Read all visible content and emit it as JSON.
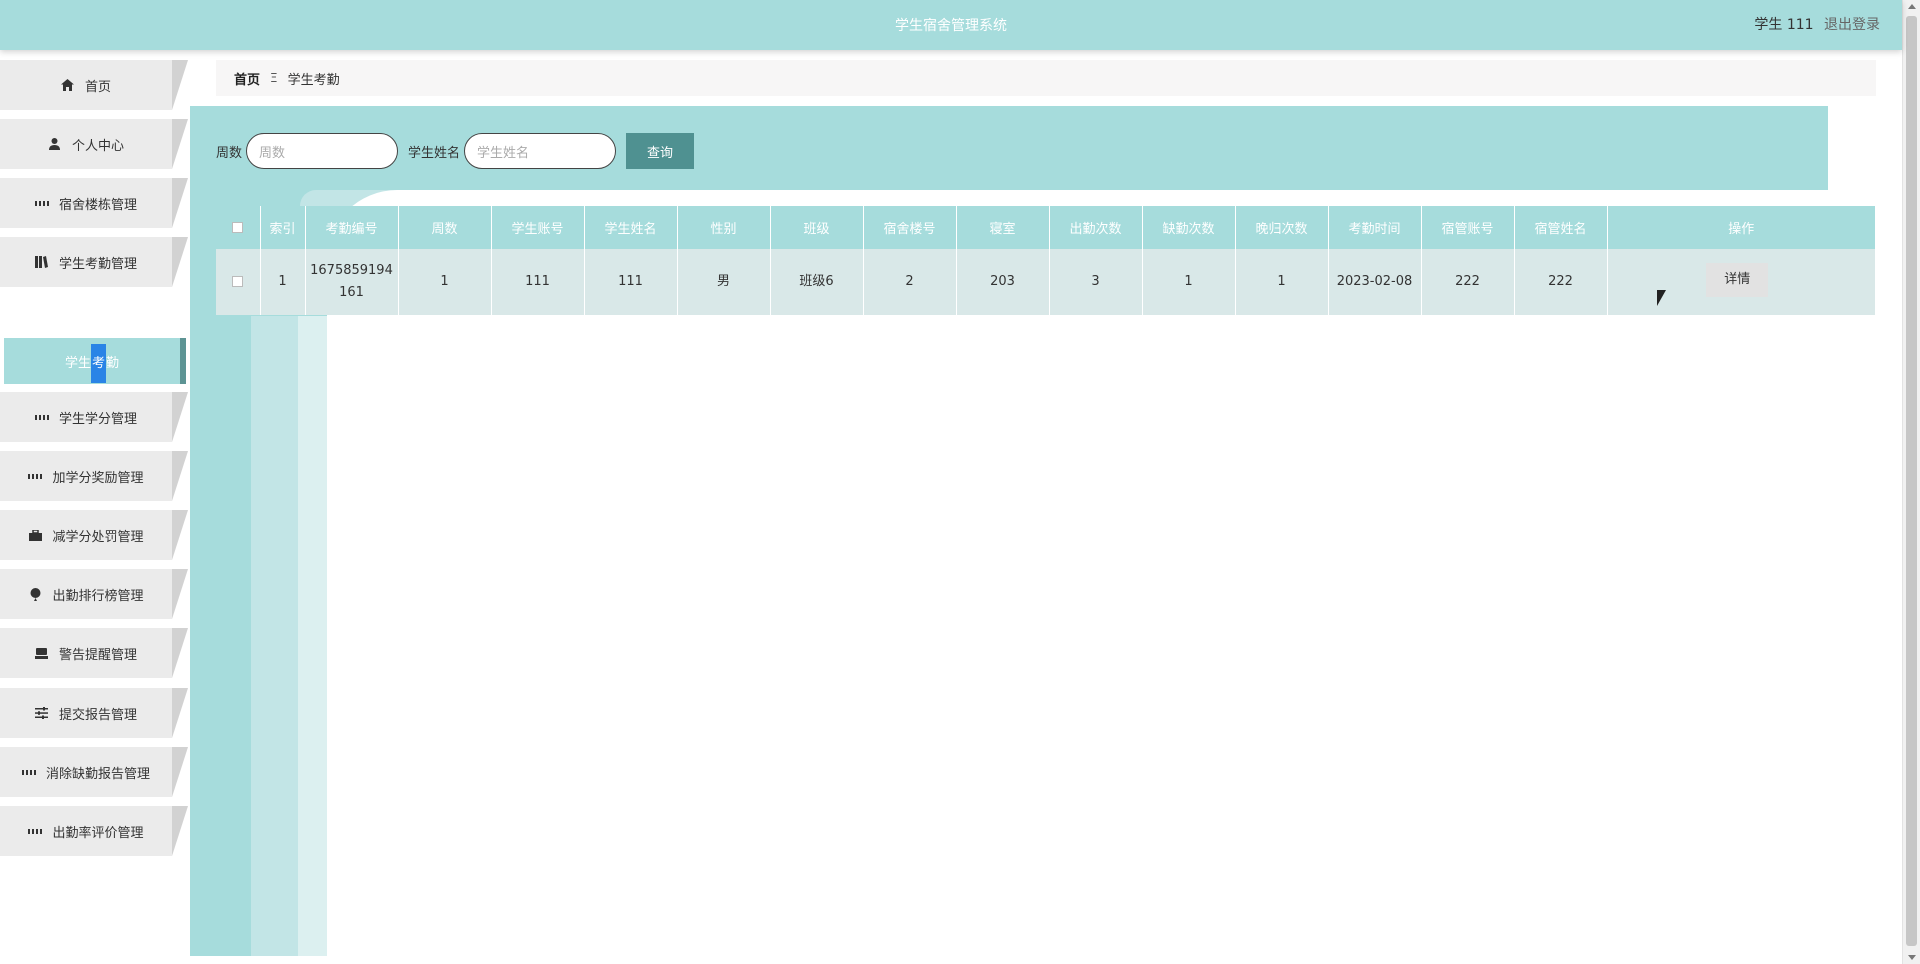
{
  "header": {
    "app_title": "学生宿舍管理系统",
    "user_label": "学生 111",
    "logout_label": "退出登录"
  },
  "sidebar": {
    "items": [
      {
        "label": "首页",
        "icon": "home-icon"
      },
      {
        "label": "个人中心",
        "icon": "user-icon"
      },
      {
        "label": "宿舍楼栋管理",
        "icon": "grid-icon"
      },
      {
        "label": "学生考勤管理",
        "icon": "book-icon"
      },
      {
        "label": "学生学分管理",
        "icon": "grid-icon"
      },
      {
        "label": "加学分奖励管理",
        "icon": "grid-icon"
      },
      {
        "label": "减学分处罚管理",
        "icon": "briefcase-icon"
      },
      {
        "label": "出勤排行榜管理",
        "icon": "balloon-icon"
      },
      {
        "label": "警告提醒管理",
        "icon": "printer-icon"
      },
      {
        "label": "提交报告管理",
        "icon": "sliders-icon"
      },
      {
        "label": "消除缺勤报告管理",
        "icon": "grid-icon"
      },
      {
        "label": "出勤率评价管理",
        "icon": "grid-icon"
      }
    ],
    "active_submenu": "学生考勤"
  },
  "breadcrumb": {
    "home": "首页",
    "separator": "Ξ",
    "current": "学生考勤"
  },
  "search": {
    "week_label": "周数",
    "week_placeholder": "周数",
    "name_label": "学生姓名",
    "name_placeholder": "学生姓名",
    "query_label": "查询"
  },
  "table": {
    "headers": [
      "索引",
      "考勤编号",
      "周数",
      "学生账号",
      "学生姓名",
      "性别",
      "班级",
      "宿舍楼号",
      "寝室",
      "出勤次数",
      "缺勤次数",
      "晚归次数",
      "考勤时间",
      "宿管账号",
      "宿管姓名",
      "操作"
    ],
    "rows": [
      {
        "index": "1",
        "attendance_no_line1": "1675859194",
        "attendance_no_line2": "161",
        "week": "1",
        "student_account": "111",
        "student_name": "111",
        "gender": "男",
        "class": "班级6",
        "building_no": "2",
        "room": "203",
        "attendance_count": "3",
        "absence_count": "1",
        "late_count": "1",
        "attendance_time": "2023-02-08",
        "warden_account": "222",
        "warden_name": "222",
        "action_label": "详情"
      }
    ]
  },
  "colors": {
    "teal": "#a6dcdc",
    "teal_dark": "#4f9191",
    "row_bg": "#d9e8e8"
  }
}
